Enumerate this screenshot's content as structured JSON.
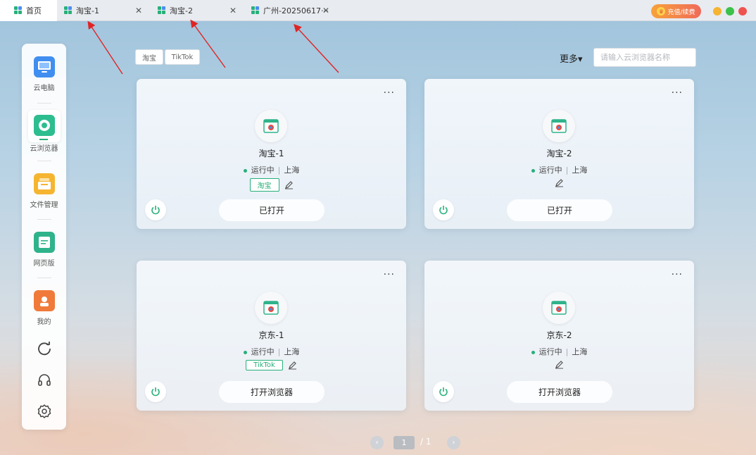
{
  "tabs": [
    {
      "label": "首页",
      "closable": false,
      "active": true
    },
    {
      "label": "淘宝-1",
      "closable": true,
      "active": false
    },
    {
      "label": "淘宝-2",
      "closable": true,
      "active": false
    },
    {
      "label": "广州-20250617···",
      "closable": true,
      "active": false
    }
  ],
  "close_glyph": "✕",
  "header": {
    "recharge_label": "充值/续费"
  },
  "window_controls": {
    "minimize_color": "#f5b431",
    "maximize_color": "#3cc24a",
    "close_color": "#ef5350"
  },
  "sidebar": {
    "items": [
      {
        "label": "云电脑",
        "icon": "monitor-icon"
      },
      {
        "label": "云浏览器",
        "icon": "cloud-browser-icon"
      },
      {
        "label": "文件管理",
        "icon": "folder-icon"
      },
      {
        "label": "网页版",
        "icon": "web-icon"
      },
      {
        "label": "我的",
        "icon": "user-icon"
      }
    ],
    "tools": [
      "refresh-icon",
      "headset-icon",
      "gear-icon"
    ]
  },
  "filters": [
    "淘宝",
    "TikTok"
  ],
  "toolbar": {
    "more_label": "更多▾"
  },
  "search": {
    "placeholder": "请输入云浏览器名称",
    "value": ""
  },
  "cards": [
    {
      "name": "淘宝-1",
      "status": "运行中",
      "region": "上海",
      "tag": "淘宝",
      "action": "已打开",
      "more": "···"
    },
    {
      "name": "淘宝-2",
      "status": "运行中",
      "region": "上海",
      "tag": "",
      "action": "已打开",
      "more": "···"
    },
    {
      "name": "京东-1",
      "status": "运行中",
      "region": "上海",
      "tag": "TikTok",
      "action": "打开浏览器",
      "more": "···"
    },
    {
      "name": "京东-2",
      "status": "运行中",
      "region": "上海",
      "tag": "",
      "action": "打开浏览器",
      "more": "···"
    }
  ],
  "separator": "|",
  "pagination": {
    "current": "1",
    "total_text": "/ 1",
    "prev": "‹",
    "next": "›"
  },
  "colors": {
    "accent": "#27b07a",
    "recharge_gradient": [
      "#f7a23a",
      "#f06a5a"
    ],
    "arrow": "#e02424"
  }
}
